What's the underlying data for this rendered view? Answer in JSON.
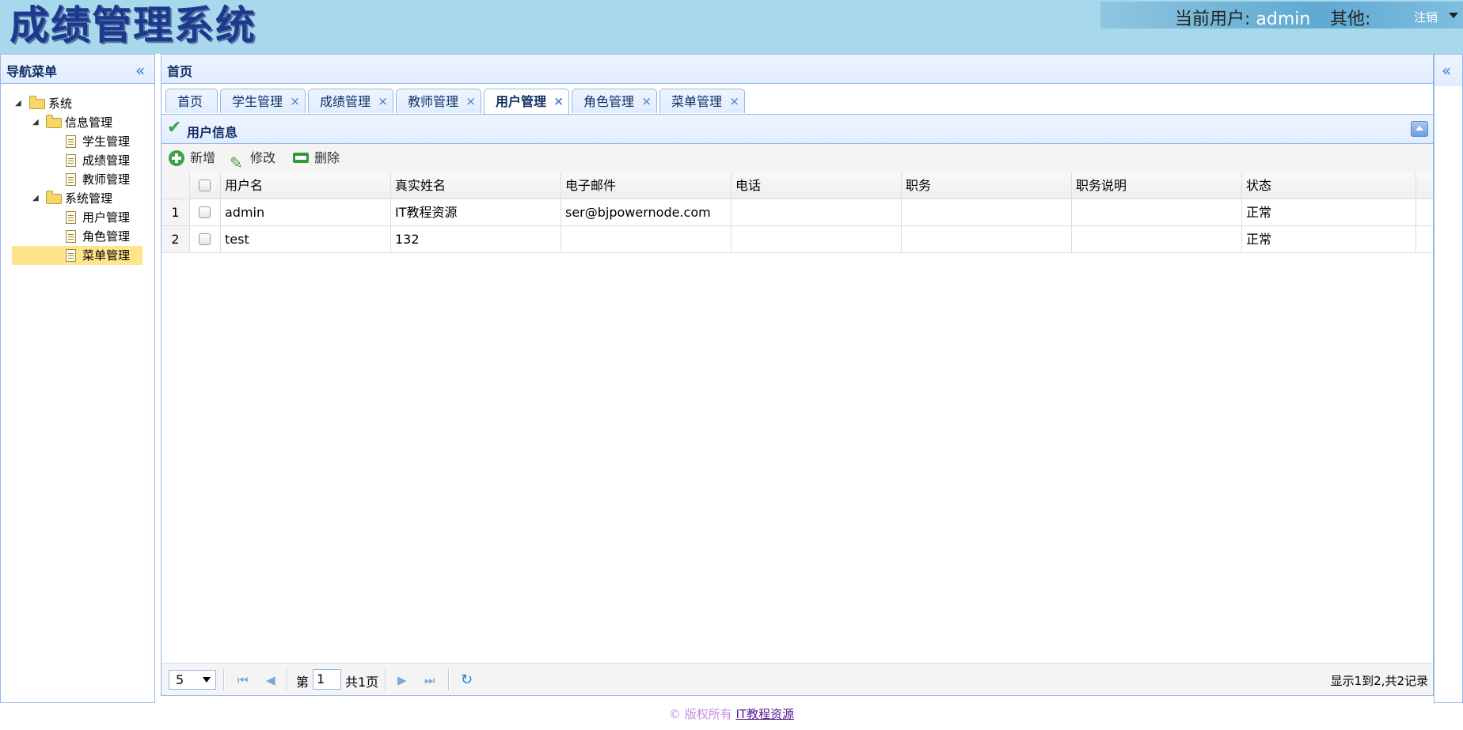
{
  "header": {
    "app_title": "成绩管理系统",
    "current_user_label": "当前用户: ",
    "current_user": "admin",
    "other_label": "其他:",
    "logout_label": "注销"
  },
  "west": {
    "title": "导航菜单",
    "collapse_glyph": "«",
    "tree": {
      "root": "系统",
      "groups": [
        {
          "label": "信息管理",
          "items": [
            "学生管理",
            "成绩管理",
            "教师管理"
          ]
        },
        {
          "label": "系统管理",
          "items": [
            "用户管理",
            "角色管理",
            "菜单管理"
          ]
        }
      ],
      "selected": "菜单管理"
    }
  },
  "center": {
    "title": "首页",
    "tabs": [
      {
        "label": "首页",
        "closable": false
      },
      {
        "label": "学生管理",
        "closable": true
      },
      {
        "label": "成绩管理",
        "closable": true
      },
      {
        "label": "教师管理",
        "closable": true
      },
      {
        "label": "用户管理",
        "closable": true,
        "active": true
      },
      {
        "label": "角色管理",
        "closable": true
      },
      {
        "label": "菜单管理",
        "closable": true
      }
    ],
    "close_glyph": "×"
  },
  "panel": {
    "title": "用户信息",
    "toolbar": {
      "add": "新增",
      "edit": "修改",
      "delete": "删除"
    },
    "columns": [
      "用户名",
      "真实姓名",
      "电子邮件",
      "电话",
      "职务",
      "职务说明",
      "状态"
    ],
    "rows": [
      {
        "no": "1",
        "cells": [
          "admin",
          "IT教程资源",
          "ser@bjpowernode.com",
          "",
          "",
          "",
          "正常"
        ]
      },
      {
        "no": "2",
        "cells": [
          "test",
          "132",
          "",
          "",
          "",
          "",
          "正常"
        ]
      }
    ],
    "pager": {
      "page_size": "5",
      "page_label": "第",
      "page_value": "1",
      "total_pages": "共1页",
      "info": "显示1到2,共2记录"
    }
  },
  "east": {
    "expand_glyph": "«"
  },
  "footer": {
    "prefix": "© 版权所有 ",
    "link": "IT教程资源"
  },
  "colors": {
    "header_bg": "#a7d8eb",
    "border": "#95b8e7",
    "selected": "#ffe48d",
    "title": "#1b3a8c"
  }
}
